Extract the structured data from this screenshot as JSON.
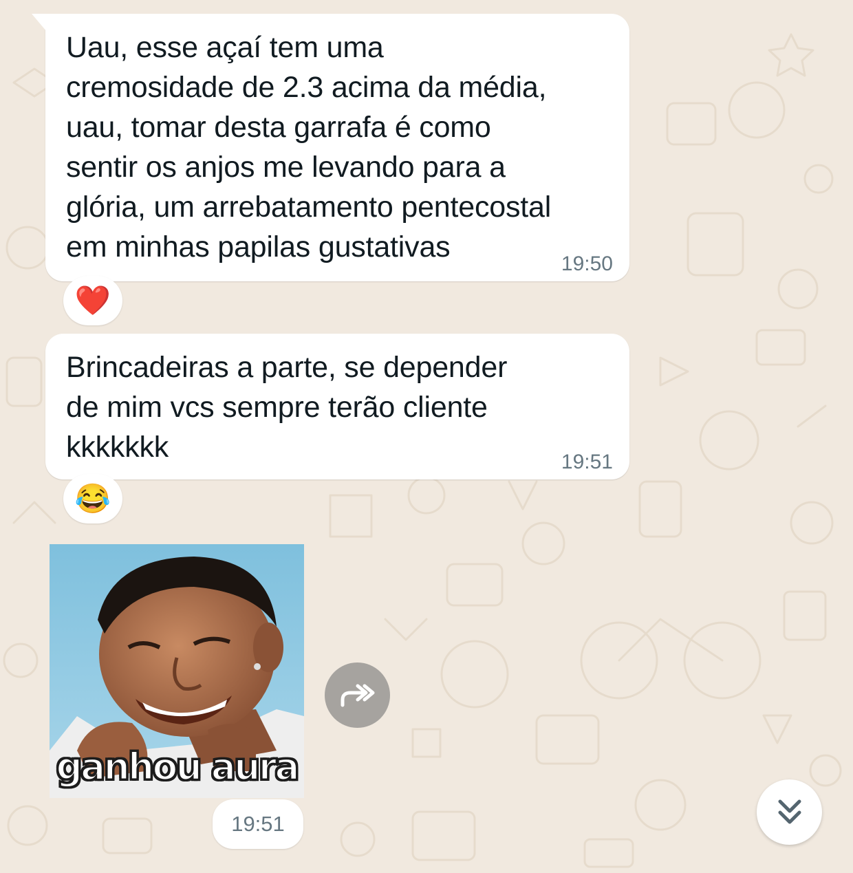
{
  "messages": [
    {
      "text": "Uau, esse açaí tem uma\ncremosidade de 2.3 acima da média,\nuau, tomar desta garrafa é como\nsentir os anjos me levando para a\nglória, um arrebatamento pentecostal\nem minhas papilas gustativas",
      "time": "19:50",
      "reaction": "❤️"
    },
    {
      "text": "Brincadeiras a parte, se depender\nde mim vcs sempre terão cliente\nkkkkkkk",
      "time": "19:51",
      "reaction": "😂"
    }
  ],
  "sticker": {
    "caption": "ganhou aura",
    "time": "19:51"
  },
  "icons": {
    "forward": "forward-icon",
    "scroll_down": "double-chevron-down-icon"
  },
  "colors": {
    "background": "#f1e9df",
    "bubble": "#ffffff",
    "text": "#111b21",
    "timestamp": "#667781"
  }
}
